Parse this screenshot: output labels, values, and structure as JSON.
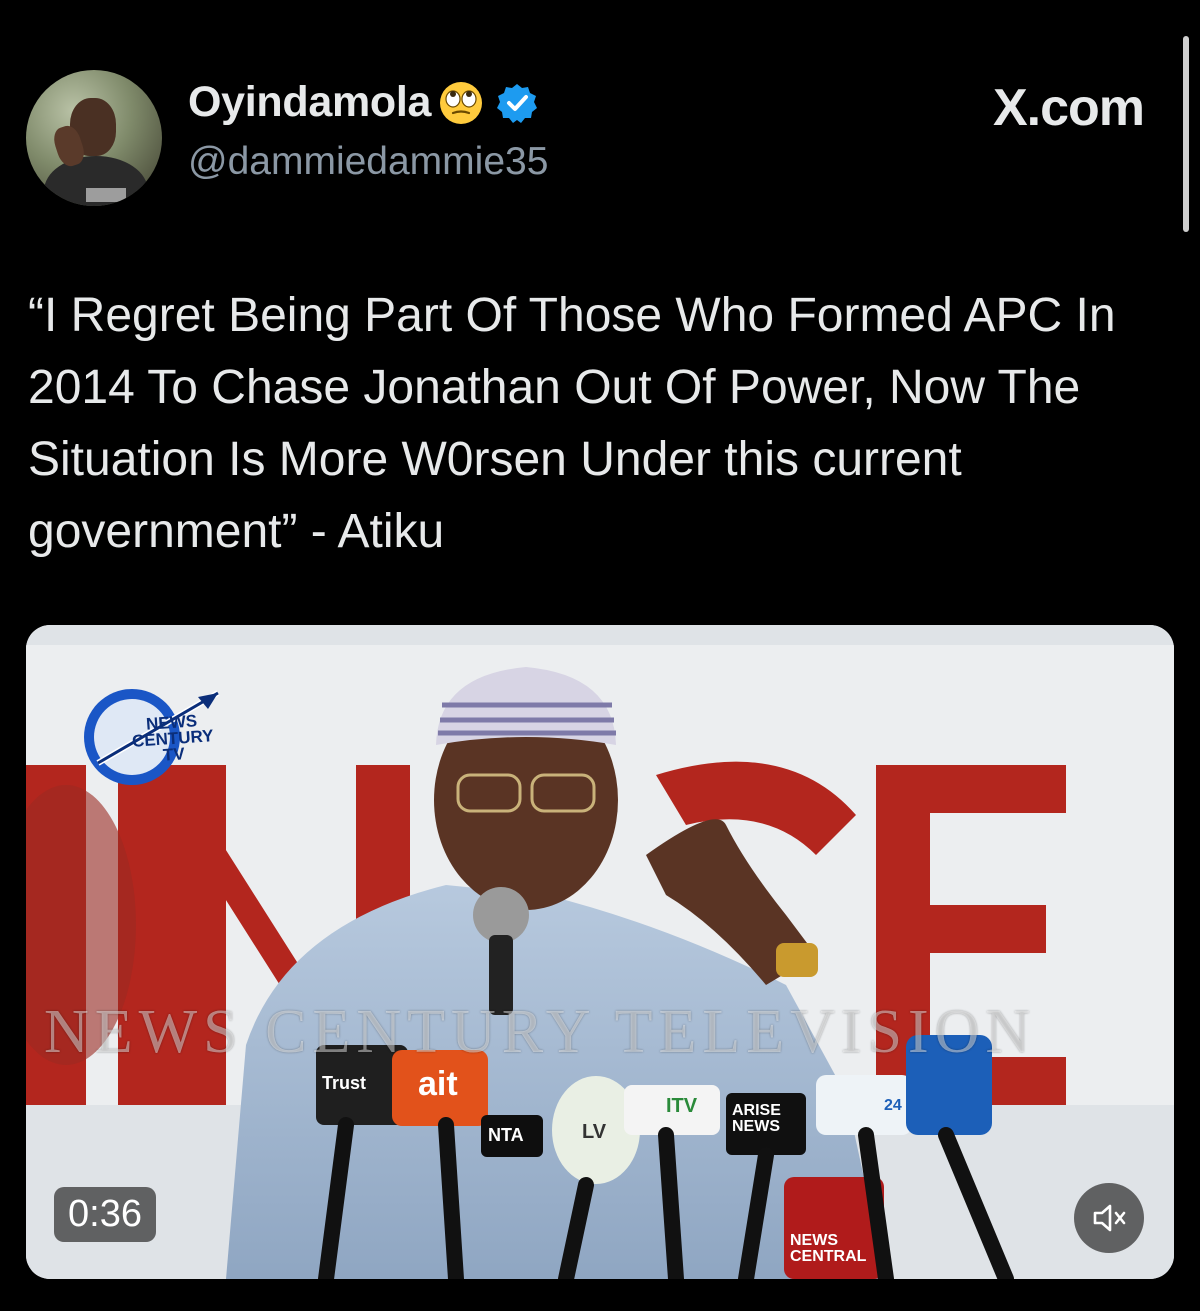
{
  "post": {
    "display_name": "Oyindamola",
    "name_emoji": "rolling-eyes-emoji",
    "verified_icon": "verified-badge-icon",
    "handle": "@dammiedammie35",
    "text": "“I Regret Being Part Of Those Who Formed APC In 2014 To Chase Jonathan Out Of Power, Now The Situation Is More W0rsen Under this current government” - Atiku"
  },
  "brand": {
    "label": "X.com"
  },
  "video": {
    "duration": "0:36",
    "mute_icon": "speaker-muted-icon",
    "overlay": {
      "logo_line1": "NEWS",
      "logo_line2": "CENTURY",
      "logo_line3": "TV",
      "watermark": "NEWS CENTURY TELEVISION",
      "mic_labels": [
        "Trust",
        "ait",
        "NTA",
        "LV",
        "ITV",
        "ARISE NEWS",
        "24",
        "NEWS CENTRAL"
      ]
    }
  },
  "colors": {
    "background": "#000000",
    "text": "#e7e9ea",
    "secondary_text": "#8b98a5",
    "verified": "#1d9bf0"
  }
}
